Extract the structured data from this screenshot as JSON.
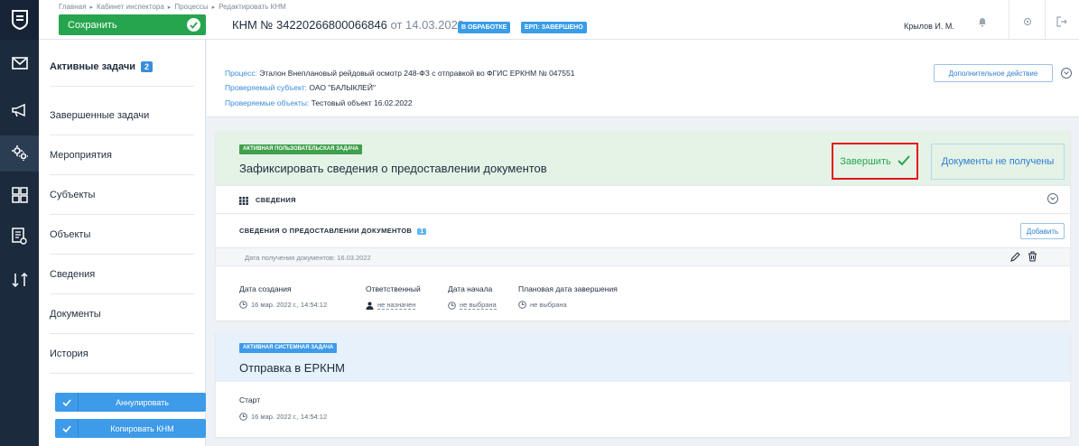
{
  "breadcrumbs": [
    "Главная",
    "Кабинет инспектора",
    "Процессы",
    "Редактировать КНМ"
  ],
  "header": {
    "save_label": "Сохранить",
    "title": "КНМ № 34220266800066846",
    "title_date": "от 14.03.2022",
    "status_badges": [
      "В ОБРАБОТКЕ",
      "ЕРП: ЗАВЕРШЕНО"
    ],
    "user": "Крылов И. М."
  },
  "sidebar": {
    "items": [
      {
        "label": "Активные задачи",
        "badge": "2"
      },
      {
        "label": "Завершенные задачи"
      },
      {
        "label": "Мероприятия"
      },
      {
        "label": "Субъекты"
      },
      {
        "label": "Объекты"
      },
      {
        "label": "Сведения"
      },
      {
        "label": "Документы"
      },
      {
        "label": "История"
      }
    ],
    "actions": [
      "Аннулировать",
      "Копировать КНМ"
    ]
  },
  "process": {
    "process_label": "Процесс:",
    "process_value": "Эталон Внеплановый рейдовый осмотр 248-ФЗ с отправкой во ФГИС ЕРКНМ № 047551",
    "subject_label": "Проверяемый субъект:",
    "subject_value": "ОАО \"БАЛЫКЛЕЙ\"",
    "objects_label": "Проверяемые объекты:",
    "objects_value": "Тестовый объект 16.02.2022",
    "extra_action": "Дополнительное действие"
  },
  "task1": {
    "badge": "АКТИВНАЯ ПОЛЬЗОВАТЕЛЬСКАЯ ЗАДАЧА",
    "title": "Зафиксировать сведения о предоставлении документов",
    "finish_label": "Завершить",
    "nodocs_label": "Документы не получены",
    "info_section": "СВЕДЕНИЯ",
    "docs_section": "СВЕДЕНИЯ О ПРЕДОСТАВЛЕНИИ ДОКУМЕНТОВ",
    "docs_count": "1",
    "add_label": "Добавить",
    "docs_row": "Дата получения документов: 16.03.2022",
    "columns": [
      {
        "header": "Дата создания",
        "value": "16 мар. 2022 г., 14:54:12"
      },
      {
        "header": "Ответственный",
        "value": "не назначен"
      },
      {
        "header": "Дата начала",
        "value": "не выбрана"
      },
      {
        "header": "Плановая дата завершения",
        "value": "не выбрана"
      }
    ]
  },
  "task2": {
    "badge": "АКТИВНАЯ СИСТЕМНАЯ ЗАДАЧА",
    "title": "Отправка в ЕРКНМ",
    "start_label": "Старт",
    "start_value": "16 мар. 2022 г., 14:54:12"
  },
  "colors": {
    "rail": "#1b2a3c",
    "save_green": "#27a54e",
    "accent_blue": "#3d9be9",
    "highlight_red": "#e4151b"
  }
}
